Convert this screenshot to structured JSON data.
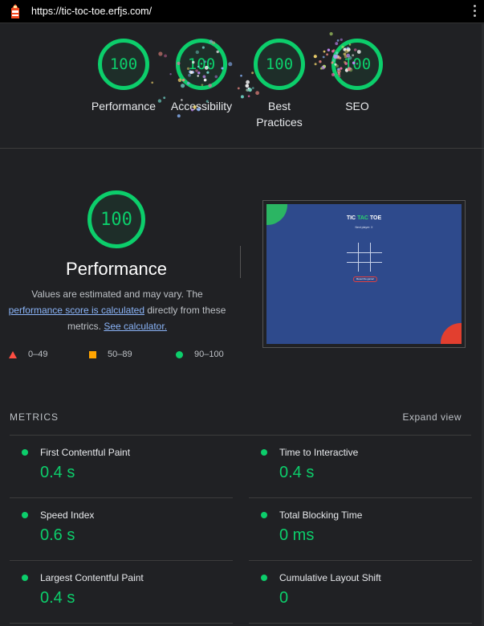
{
  "topbar": {
    "url": "https://tic-toc-toe.erfjs.com/",
    "logo_icon": "lighthouse-icon",
    "menu_icon": "kebab-menu-icon"
  },
  "colors": {
    "pass": "#0cce6b",
    "average": "#ffa400",
    "fail": "#ff4e42",
    "link": "#8ab4f8",
    "background": "#202124"
  },
  "gauges": [
    {
      "score": "100",
      "label": "Performance",
      "fraction": 1.0
    },
    {
      "score": "100",
      "label": "Accessibility",
      "fraction": 1.0
    },
    {
      "score": "100",
      "label": "Best Practices",
      "fraction": 1.0
    },
    {
      "score": "100",
      "label": "SEO",
      "fraction": 1.0
    }
  ],
  "performance": {
    "score": "100",
    "title": "Performance",
    "desc_prefix": "Values are estimated and may vary. The",
    "desc_link": "performance score is calculated",
    "desc_mid": "directly from these metrics.",
    "desc_link2": "See calculator."
  },
  "legend": [
    {
      "shape": "triangle",
      "range": "0–49"
    },
    {
      "shape": "square",
      "range": "50–89"
    },
    {
      "shape": "circle",
      "range": "90–100"
    }
  ],
  "screenshot": {
    "title_a": "TIC ",
    "title_b": "TAC",
    "title_c": " TOE",
    "subtitle": "Next player: X",
    "button": "Reset the game!"
  },
  "metrics": {
    "heading": "METRICS",
    "expand": "Expand view",
    "items": [
      {
        "name": "First Contentful Paint",
        "value": "0.4 s"
      },
      {
        "name": "Time to Interactive",
        "value": "0.4 s"
      },
      {
        "name": "Speed Index",
        "value": "0.6 s"
      },
      {
        "name": "Total Blocking Time",
        "value": "0 ms"
      },
      {
        "name": "Largest Contentful Paint",
        "value": "0.4 s"
      },
      {
        "name": "Cumulative Layout Shift",
        "value": "0"
      }
    ]
  }
}
